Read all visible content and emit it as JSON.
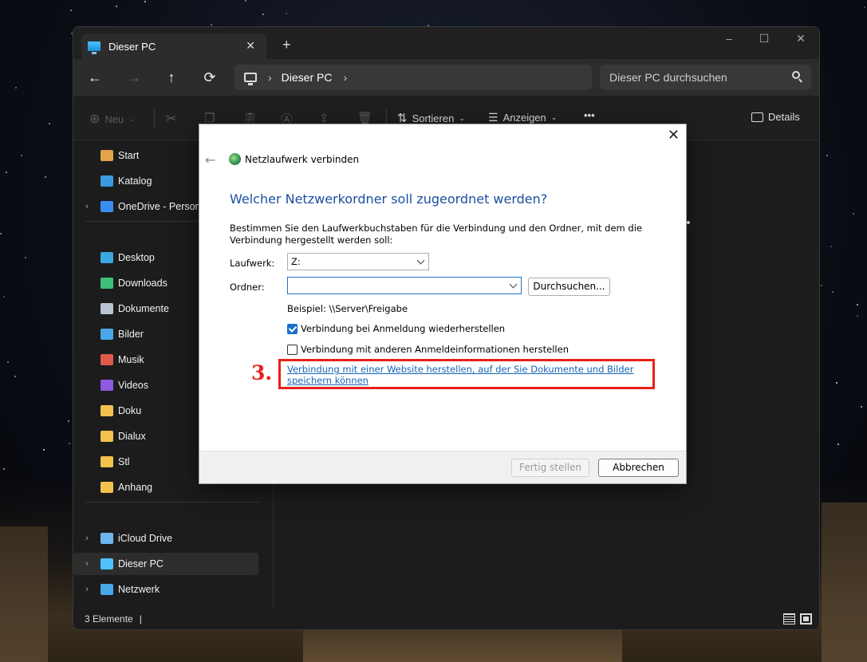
{
  "explorer": {
    "tab_title": "Dieser PC",
    "tab_close": "✕",
    "new_tab": "+",
    "window_controls": [
      "–",
      "☐",
      "✕"
    ],
    "nav": {
      "back": "←",
      "forward": "→",
      "up": "↑",
      "refresh": "⟳"
    },
    "address": {
      "segment": "Dieser PC",
      "chevron": "›"
    },
    "search_placeholder": "Dieser PC durchsuchen",
    "toolbar": {
      "new": "Neu",
      "sort": "Sortieren",
      "view": "Anzeigen",
      "more": "•••",
      "details": "Details"
    },
    "sidebar": [
      {
        "label": "Start",
        "icon": "home-icon",
        "color": "#e3a34a"
      },
      {
        "label": "Katalog",
        "icon": "gallery-icon",
        "color": "#3a9be0"
      },
      {
        "label": "OneDrive - Persona",
        "icon": "cloud-icon",
        "color": "#3a8ef0",
        "expandable": true
      },
      {
        "label": "Desktop",
        "icon": "desktop-icon",
        "color": "#3aa7e0"
      },
      {
        "label": "Downloads",
        "icon": "download-icon",
        "color": "#3fbf77"
      },
      {
        "label": "Dokumente",
        "icon": "document-icon",
        "color": "#b9c3cf"
      },
      {
        "label": "Bilder",
        "icon": "pictures-icon",
        "color": "#4aa8e8"
      },
      {
        "label": "Musik",
        "icon": "music-icon",
        "color": "#e05a4a"
      },
      {
        "label": "Videos",
        "icon": "video-icon",
        "color": "#8d5ae0"
      },
      {
        "label": "Doku",
        "icon": "folder-icon",
        "color": "#f2c14e"
      },
      {
        "label": "Dialux",
        "icon": "folder-icon",
        "color": "#f2c14e"
      },
      {
        "label": "Stl",
        "icon": "folder-icon",
        "color": "#f2c14e"
      },
      {
        "label": "Anhang",
        "icon": "folder-icon",
        "color": "#f2c14e"
      },
      {
        "label": "iCloud Drive",
        "icon": "icloud-icon",
        "color": "#6fb6f0",
        "expandable": true
      },
      {
        "label": "Dieser PC",
        "icon": "pc-icon",
        "color": "#4cc2ff",
        "expandable": true,
        "selected": true
      },
      {
        "label": "Netzwerk",
        "icon": "network-icon",
        "color": "#4aa8e8",
        "expandable": true
      }
    ],
    "status": "3 Elemente"
  },
  "dialog": {
    "title": "Netzlaufwerk verbinden",
    "heading": "Welcher Netzwerkordner soll zugeordnet werden?",
    "description": "Bestimmen Sie den Laufwerkbuchstaben für die Verbindung und den Ordner, mit dem die Verbindung hergestellt werden soll:",
    "drive_label": "Laufwerk:",
    "drive_value": "Z:",
    "folder_label": "Ordner:",
    "folder_value": "",
    "browse_button": "Durchsuchen...",
    "example": "Beispiel: \\\\Server\\Freigabe",
    "reconnect_label": "Verbindung bei Anmeldung wiederherstellen",
    "reconnect_checked": true,
    "other_credentials_label": "Verbindung mit anderen Anmeldeinformationen herstellen",
    "other_credentials_checked": false,
    "website_link": "Verbindung mit einer Website herstellen, auf der Sie Dokumente und Bilder speichern können",
    "finish_button": "Fertig stellen",
    "cancel_button": "Abbrechen",
    "close": "✕",
    "back": "←"
  },
  "annotation": {
    "step": "3.",
    "color": "#e8201a"
  }
}
